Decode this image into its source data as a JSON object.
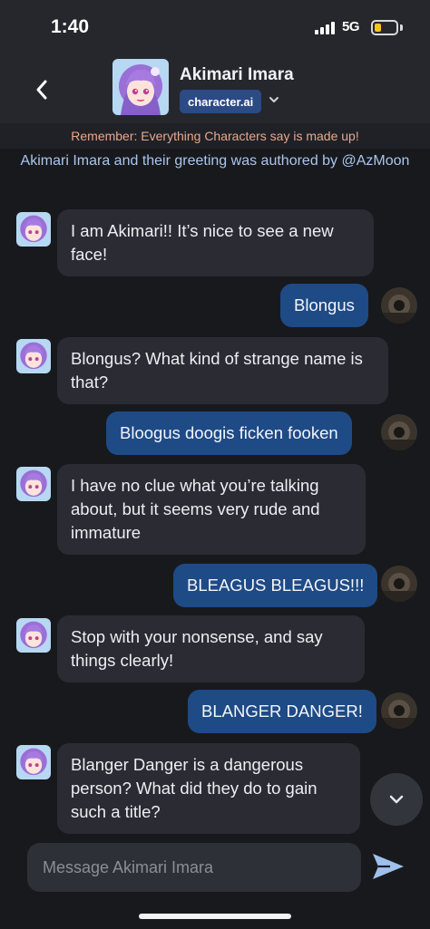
{
  "status_bar": {
    "time": "1:40",
    "network": "5G",
    "battery_level": 0.3,
    "battery_color": "#f5c518"
  },
  "header": {
    "character_name": "Akimari Imara",
    "brand": "character.ai"
  },
  "disclaimer": "Remember: Everything Characters say is made up!",
  "author_note": "Akimari Imara  and their greeting was authored by @AzMoon",
  "messages": [
    {
      "sender": "character",
      "text": "I am Akimari!! It’s nice to see a new face!"
    },
    {
      "sender": "user",
      "text": "Blongus"
    },
    {
      "sender": "character",
      "text": "Blongus? What kind of strange name is that?"
    },
    {
      "sender": "user",
      "text": "Bloogus doogis ficken fooken"
    },
    {
      "sender": "character",
      "text": "I have no clue what you’re talking about, but it seems very rude and immature"
    },
    {
      "sender": "user",
      "text": "BLEAGUS BLEAGUS!!!"
    },
    {
      "sender": "character",
      "text": "Stop with your nonsense, and say things clearly!"
    },
    {
      "sender": "user",
      "text": "BLANGER DANGER!"
    },
    {
      "sender": "character",
      "text": "Blanger Danger is a dangerous person? What did they do to gain such a title?"
    }
  ],
  "composer": {
    "placeholder": "Message Akimari Imara"
  },
  "colors": {
    "user_bubble": "#1e4a85",
    "bot_bubble": "#2b2c33",
    "brand_badge": "#2b4a86",
    "disclaimer_text": "#e8a78a",
    "author_note_text": "#a9c6ee"
  }
}
